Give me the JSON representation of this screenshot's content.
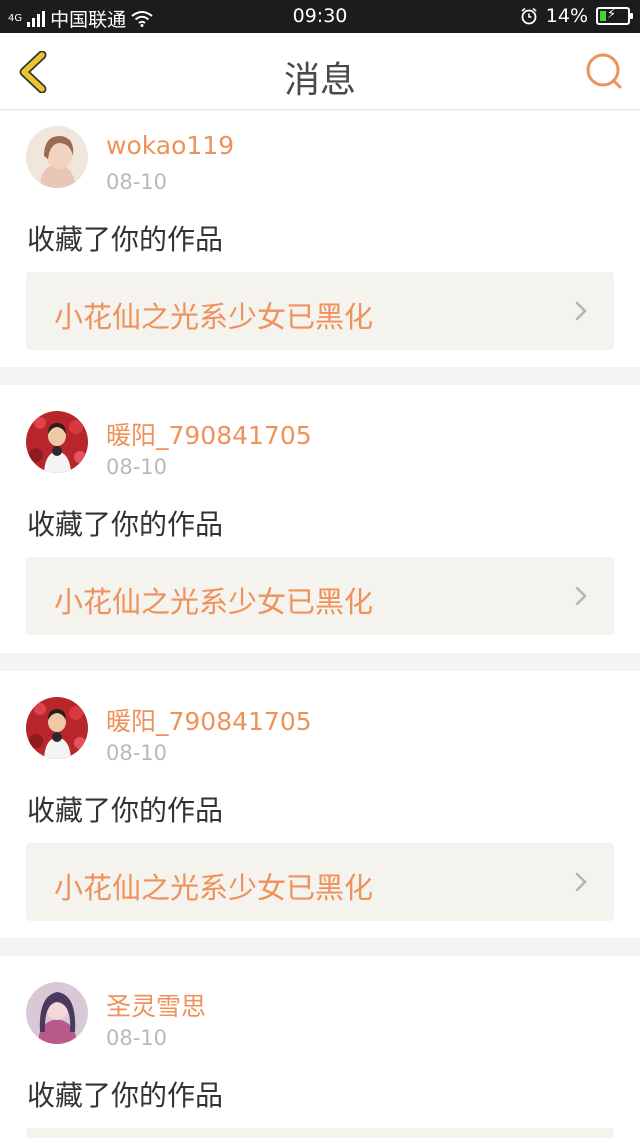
{
  "status_bar": {
    "network": "4G",
    "carrier": "中国联通",
    "time": "09:30",
    "battery": "14%",
    "icons": [
      "signal-icon",
      "wifi-icon",
      "alarm-icon",
      "battery-charging-icon"
    ]
  },
  "header": {
    "title": "消息",
    "back_icon": "chevron-left-icon",
    "search_icon": "search-icon",
    "accent_color": "#ef915a",
    "back_color": "#e7c72d"
  },
  "messages": [
    {
      "username": "wokao119",
      "date": "08-10",
      "action": "收藏了你的作品",
      "work_title": "小花仙之光系少女已黑化"
    },
    {
      "username": "暖阳_790841705",
      "date": "08-10",
      "action": "收藏了你的作品",
      "work_title": "小花仙之光系少女已黑化"
    },
    {
      "username": "暖阳_790841705",
      "date": "08-10",
      "action": "收藏了你的作品",
      "work_title": "小花仙之光系少女已黑化"
    },
    {
      "username": "圣灵雪思",
      "date": "08-10",
      "action": "收藏了你的作品",
      "work_title": ""
    }
  ]
}
